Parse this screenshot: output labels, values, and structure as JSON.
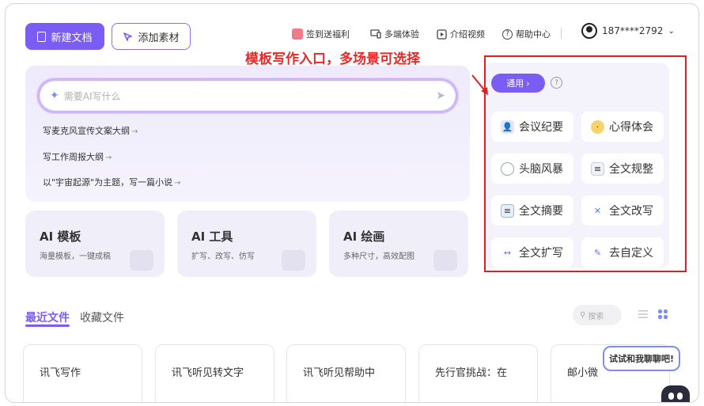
{
  "toolbar": {
    "new_doc_label": "新建文档",
    "add_material_label": "添加素材"
  },
  "topnav": {
    "items": [
      {
        "label": "签到送福利",
        "icon": "gift-icon"
      },
      {
        "label": "多端体验",
        "icon": "devices-icon"
      },
      {
        "label": "介绍视频",
        "icon": "video-icon"
      },
      {
        "label": "帮助中心",
        "icon": "help-circle-icon"
      }
    ],
    "user": "187****2792"
  },
  "hero": {
    "placeholder": "需要AI写什么",
    "suggestions": [
      "写麦克风宣传文案大纲",
      "写工作周报大纲",
      "以\"宇宙起源\"为主题，写一篇小说"
    ]
  },
  "cards": [
    {
      "title": "AI 模板",
      "subtitle": "海量模板，一键成稿"
    },
    {
      "title": "AI 工具",
      "subtitle": "扩写、改写、仿写"
    },
    {
      "title": "AI 绘画",
      "subtitle": "多种尺寸，高效配图"
    }
  ],
  "templates": {
    "tag": "通用",
    "items": [
      "会议纪要",
      "心得体会",
      "头脑风暴",
      "全文规整",
      "全文摘要",
      "全文改写",
      "全文扩写",
      "去自定义"
    ]
  },
  "annotation": "模板写作入口，多场景可选择",
  "files": {
    "tab_recent": "最近文件",
    "tab_favorites": "收藏文件",
    "search_placeholder": "搜索",
    "items": [
      "讯飞写作",
      "讯飞听见转文字",
      "讯飞听见帮助中",
      "先行官挑战：在",
      "邮小微"
    ]
  },
  "chat": {
    "bubble": "试试和我聊聊吧!"
  },
  "colors": {
    "accent": "#7b5cf5",
    "annotation": "#e02020"
  }
}
